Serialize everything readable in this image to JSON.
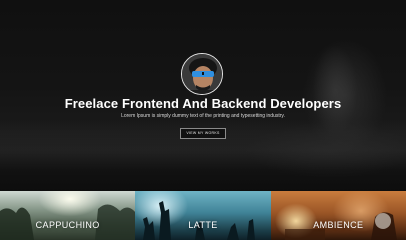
{
  "hero": {
    "title": "Freelace Frontend And Backend Developers",
    "subtitle": "Lorem Ipsum is simply dummy text of the printing and typesetting industry.",
    "button_label": "VIEW MY WORKS"
  },
  "tiles": [
    {
      "label": "CAPPUCHINO"
    },
    {
      "label": "LATTE"
    },
    {
      "label": "AMBIENCE"
    }
  ],
  "colors": {
    "background": "#0b0b0b",
    "text": "#ffffff",
    "button_border": "#8a8a8a"
  }
}
